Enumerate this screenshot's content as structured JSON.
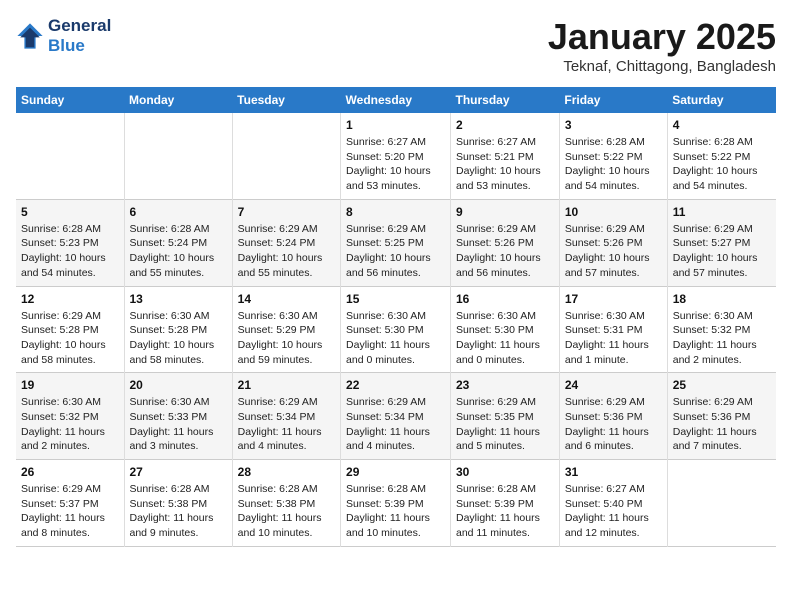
{
  "logo": {
    "line1": "General",
    "line2": "Blue"
  },
  "calendar": {
    "title": "January 2025",
    "subtitle": "Teknaf, Chittagong, Bangladesh"
  },
  "headers": [
    "Sunday",
    "Monday",
    "Tuesday",
    "Wednesday",
    "Thursday",
    "Friday",
    "Saturday"
  ],
  "weeks": [
    [
      {
        "day": "",
        "info": ""
      },
      {
        "day": "",
        "info": ""
      },
      {
        "day": "",
        "info": ""
      },
      {
        "day": "1",
        "info": "Sunrise: 6:27 AM\nSunset: 5:20 PM\nDaylight: 10 hours\nand 53 minutes."
      },
      {
        "day": "2",
        "info": "Sunrise: 6:27 AM\nSunset: 5:21 PM\nDaylight: 10 hours\nand 53 minutes."
      },
      {
        "day": "3",
        "info": "Sunrise: 6:28 AM\nSunset: 5:22 PM\nDaylight: 10 hours\nand 54 minutes."
      },
      {
        "day": "4",
        "info": "Sunrise: 6:28 AM\nSunset: 5:22 PM\nDaylight: 10 hours\nand 54 minutes."
      }
    ],
    [
      {
        "day": "5",
        "info": "Sunrise: 6:28 AM\nSunset: 5:23 PM\nDaylight: 10 hours\nand 54 minutes."
      },
      {
        "day": "6",
        "info": "Sunrise: 6:28 AM\nSunset: 5:24 PM\nDaylight: 10 hours\nand 55 minutes."
      },
      {
        "day": "7",
        "info": "Sunrise: 6:29 AM\nSunset: 5:24 PM\nDaylight: 10 hours\nand 55 minutes."
      },
      {
        "day": "8",
        "info": "Sunrise: 6:29 AM\nSunset: 5:25 PM\nDaylight: 10 hours\nand 56 minutes."
      },
      {
        "day": "9",
        "info": "Sunrise: 6:29 AM\nSunset: 5:26 PM\nDaylight: 10 hours\nand 56 minutes."
      },
      {
        "day": "10",
        "info": "Sunrise: 6:29 AM\nSunset: 5:26 PM\nDaylight: 10 hours\nand 57 minutes."
      },
      {
        "day": "11",
        "info": "Sunrise: 6:29 AM\nSunset: 5:27 PM\nDaylight: 10 hours\nand 57 minutes."
      }
    ],
    [
      {
        "day": "12",
        "info": "Sunrise: 6:29 AM\nSunset: 5:28 PM\nDaylight: 10 hours\nand 58 minutes."
      },
      {
        "day": "13",
        "info": "Sunrise: 6:30 AM\nSunset: 5:28 PM\nDaylight: 10 hours\nand 58 minutes."
      },
      {
        "day": "14",
        "info": "Sunrise: 6:30 AM\nSunset: 5:29 PM\nDaylight: 10 hours\nand 59 minutes."
      },
      {
        "day": "15",
        "info": "Sunrise: 6:30 AM\nSunset: 5:30 PM\nDaylight: 11 hours\nand 0 minutes."
      },
      {
        "day": "16",
        "info": "Sunrise: 6:30 AM\nSunset: 5:30 PM\nDaylight: 11 hours\nand 0 minutes."
      },
      {
        "day": "17",
        "info": "Sunrise: 6:30 AM\nSunset: 5:31 PM\nDaylight: 11 hours\nand 1 minute."
      },
      {
        "day": "18",
        "info": "Sunrise: 6:30 AM\nSunset: 5:32 PM\nDaylight: 11 hours\nand 2 minutes."
      }
    ],
    [
      {
        "day": "19",
        "info": "Sunrise: 6:30 AM\nSunset: 5:32 PM\nDaylight: 11 hours\nand 2 minutes."
      },
      {
        "day": "20",
        "info": "Sunrise: 6:30 AM\nSunset: 5:33 PM\nDaylight: 11 hours\nand 3 minutes."
      },
      {
        "day": "21",
        "info": "Sunrise: 6:29 AM\nSunset: 5:34 PM\nDaylight: 11 hours\nand 4 minutes."
      },
      {
        "day": "22",
        "info": "Sunrise: 6:29 AM\nSunset: 5:34 PM\nDaylight: 11 hours\nand 4 minutes."
      },
      {
        "day": "23",
        "info": "Sunrise: 6:29 AM\nSunset: 5:35 PM\nDaylight: 11 hours\nand 5 minutes."
      },
      {
        "day": "24",
        "info": "Sunrise: 6:29 AM\nSunset: 5:36 PM\nDaylight: 11 hours\nand 6 minutes."
      },
      {
        "day": "25",
        "info": "Sunrise: 6:29 AM\nSunset: 5:36 PM\nDaylight: 11 hours\nand 7 minutes."
      }
    ],
    [
      {
        "day": "26",
        "info": "Sunrise: 6:29 AM\nSunset: 5:37 PM\nDaylight: 11 hours\nand 8 minutes."
      },
      {
        "day": "27",
        "info": "Sunrise: 6:28 AM\nSunset: 5:38 PM\nDaylight: 11 hours\nand 9 minutes."
      },
      {
        "day": "28",
        "info": "Sunrise: 6:28 AM\nSunset: 5:38 PM\nDaylight: 11 hours\nand 10 minutes."
      },
      {
        "day": "29",
        "info": "Sunrise: 6:28 AM\nSunset: 5:39 PM\nDaylight: 11 hours\nand 10 minutes."
      },
      {
        "day": "30",
        "info": "Sunrise: 6:28 AM\nSunset: 5:39 PM\nDaylight: 11 hours\nand 11 minutes."
      },
      {
        "day": "31",
        "info": "Sunrise: 6:27 AM\nSunset: 5:40 PM\nDaylight: 11 hours\nand 12 minutes."
      },
      {
        "day": "",
        "info": ""
      }
    ]
  ]
}
